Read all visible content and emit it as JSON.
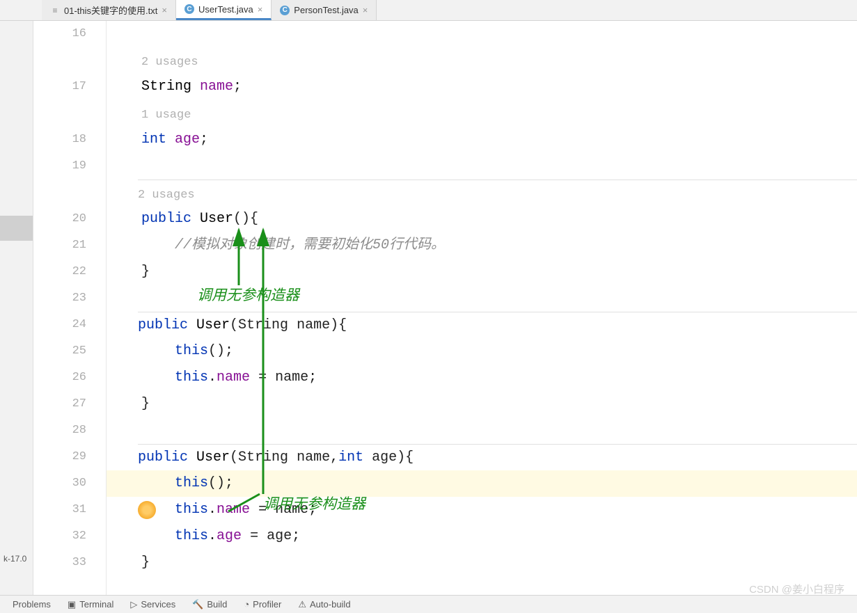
{
  "tabs": [
    {
      "label": "01-this关键字的使用.txt",
      "icon": "txt",
      "active": false
    },
    {
      "label": "UserTest.java",
      "icon": "java",
      "active": true
    },
    {
      "label": "PersonTest.java",
      "icon": "java",
      "active": false
    }
  ],
  "sidebar": {
    "jdk_label": "k-17.0"
  },
  "line_numbers": [
    "16",
    "17",
    "18",
    "19",
    "20",
    "21",
    "22",
    "23",
    "24",
    "25",
    "26",
    "27",
    "28",
    "29",
    "30",
    "31",
    "32",
    "33"
  ],
  "usage_labels": {
    "two": "2 usages",
    "one": "1 usage",
    "two_b": "2 usages"
  },
  "code": {
    "l17_1": "String",
    "l17_2": " ",
    "l17_3": "name",
    "l17_4": ";",
    "l18_1": "int",
    "l18_2": " ",
    "l18_3": "age",
    "l18_4": ";",
    "l20_1": "public",
    "l20_2": " ",
    "l20_3": "User",
    "l20_4": "(){",
    "l21": "    //模拟对象创建时，需要初始化50行代码。",
    "l22": "}",
    "l24_1": "public",
    "l24_2": " ",
    "l24_3": "User",
    "l24_4": "(String name){",
    "l25_1": "    ",
    "l25_2": "this",
    "l25_3": "();",
    "l26_1": "    ",
    "l26_2": "this",
    "l26_3": ".",
    "l26_4": "name",
    "l26_5": " = name;",
    "l27": "}",
    "l29_1": "public",
    "l29_2": " ",
    "l29_3": "User",
    "l29_4": "(String name,",
    "l29_5": "int",
    "l29_6": " age){",
    "l30_1": "    ",
    "l30_2": "this",
    "l30_3": "();",
    "l31_1": "    ",
    "l31_2": "this",
    "l31_3": ".",
    "l31_4": "name",
    "l31_5": " = name;",
    "l32_1": "    ",
    "l32_2": "this",
    "l32_3": ".",
    "l32_4": "age",
    "l32_5": " = age;",
    "l33": "}"
  },
  "annotations": {
    "a1": "调用无参构造器",
    "a2": "调用无参构造器"
  },
  "bottom": {
    "problems": "Problems",
    "terminal": "Terminal",
    "services": "Services",
    "build": "Build",
    "profiler": "Profiler",
    "autobuild": "Auto-build"
  },
  "watermark": "CSDN @姜小白程序"
}
